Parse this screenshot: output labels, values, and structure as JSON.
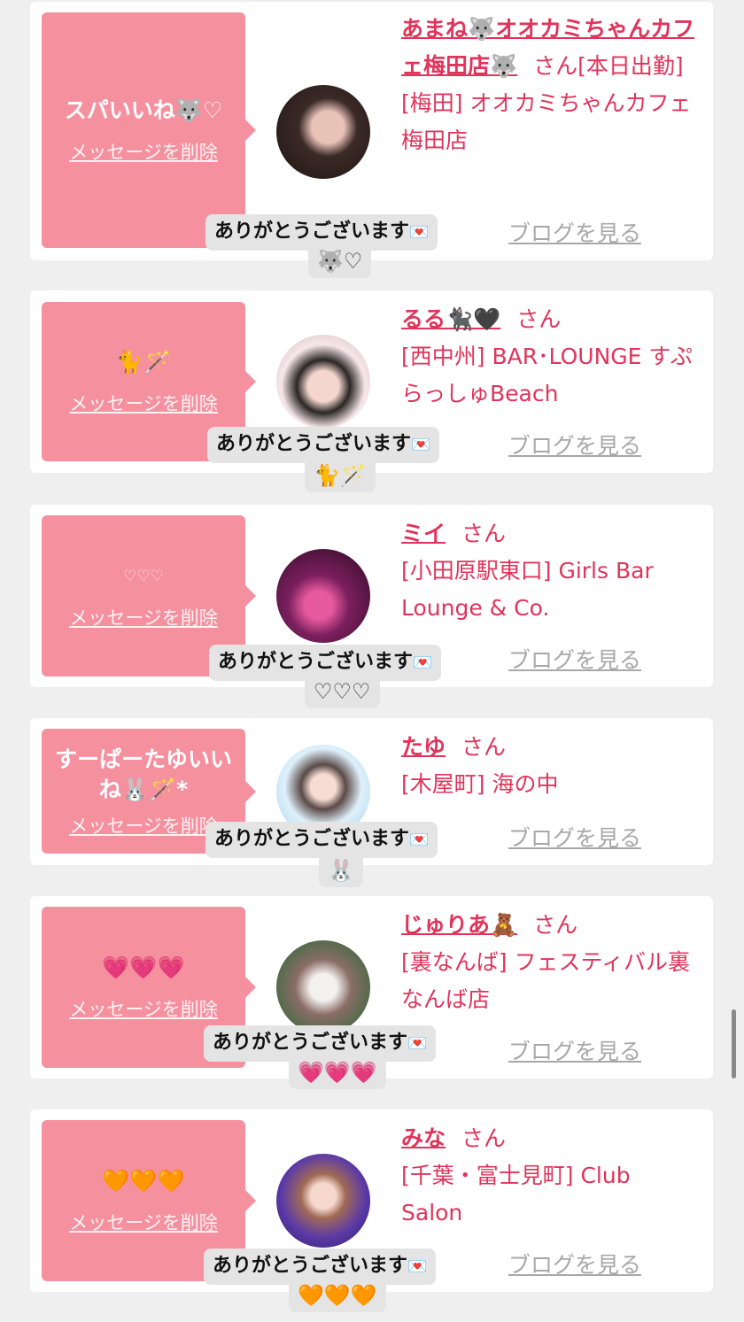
{
  "messages": {
    "delete_label": "メッセージを削除",
    "blog_label": "ブログを見る",
    "reply_label": "ありがとうございます",
    "san_label": "さん",
    "items": [
      {
        "message": "スパいいね🐺♡",
        "name": "あまね🐺オオカミちゃんカフェ梅田店🐺",
        "status": "[本日出勤]",
        "shop": "[梅田] オオカミちゃんカフェ梅田店",
        "reply_emoji": "🐺♡"
      },
      {
        "message": "🐈🪄",
        "name": "るる🐈‍⬛🖤",
        "status": "",
        "shop": "[西中州] BAR･LOUNGE すぷらっしゅBeach",
        "reply_emoji": "🐈🪄"
      },
      {
        "message": "♡♡♡",
        "name": "ミイ",
        "status": "",
        "shop": "[小田原駅東口] Girls Bar Lounge & Co.",
        "reply_emoji": "♡♡♡"
      },
      {
        "message": "すーぱーたゆいいね🐰🪄*",
        "name": "たゆ",
        "status": "",
        "shop": "[木屋町] 海の中",
        "reply_emoji": "🐰"
      },
      {
        "message": "💗💗💗",
        "name": "じゅりあ🧸",
        "status": "",
        "shop": "[裏なんば] フェスティバル裏なんば店",
        "reply_emoji": "💗💗💗"
      },
      {
        "message": "🧡🧡🧡",
        "name": "みな",
        "status": "",
        "shop": "[千葉・富士見町] Club Salon",
        "reply_emoji": "🧡🧡🧡"
      }
    ]
  },
  "colors": {
    "accent": "#e0345b",
    "message_box": "#f5909f",
    "background": "#efefef"
  }
}
